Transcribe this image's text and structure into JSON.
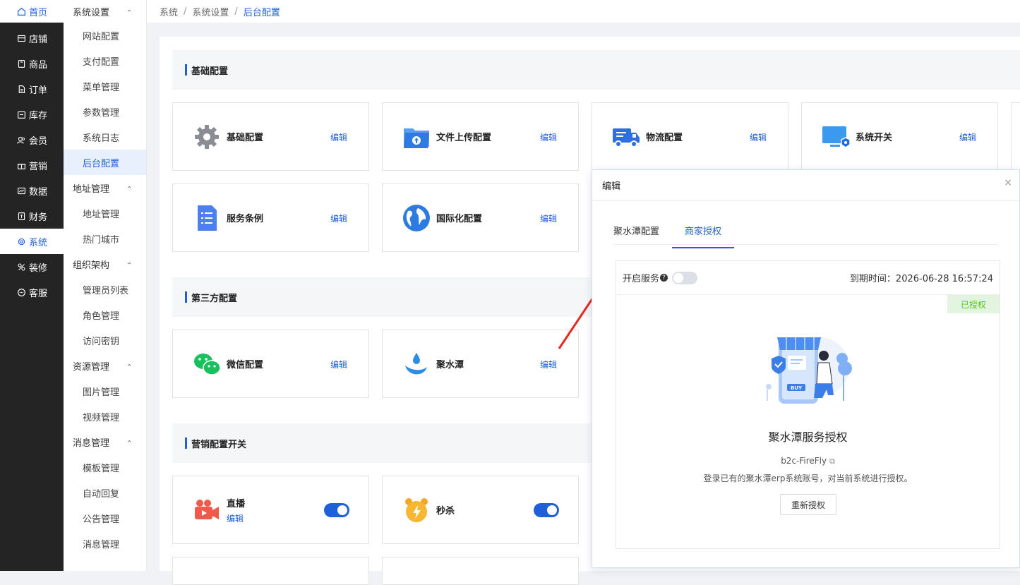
{
  "nav": {
    "home": "首页",
    "items": [
      "店铺",
      "商品",
      "订单",
      "库存",
      "会员",
      "营销",
      "数据",
      "财务",
      "系统",
      "装修",
      "客服"
    ]
  },
  "subnav": {
    "group1": "系统设置",
    "group1_items": [
      "网站配置",
      "支付配置",
      "菜单管理",
      "参数管理",
      "系统日志",
      "后台配置"
    ],
    "group2": "地址管理",
    "group2_items": [
      "地址管理",
      "热门城市"
    ],
    "group3": "组织架构",
    "group3_items": [
      "管理员列表",
      "角色管理",
      "访问密钥"
    ],
    "group4": "资源管理",
    "group4_items": [
      "图片管理",
      "视频管理"
    ],
    "group5": "消息管理",
    "group5_items": [
      "模板管理",
      "自动回复",
      "公告管理",
      "消息管理"
    ]
  },
  "breadcrumb": {
    "a": "系统",
    "b": "系统设置",
    "c": "后台配置"
  },
  "sections": {
    "basic": "基础配置",
    "third": "第三方配置",
    "marketing": "营销配置开关"
  },
  "cards": {
    "edit": "编辑",
    "basic_cfg": "基础配置",
    "upload": "文件上传配置",
    "logistics": "物流配置",
    "switch": "系统开关",
    "terms": "服务条例",
    "i18n": "国际化配置",
    "wechat": "微信配置",
    "jst": "聚水潭",
    "live": "直播",
    "seckill": "秒杀"
  },
  "dialog": {
    "title": "编辑",
    "close": "×",
    "tab1": "聚水潭配置",
    "tab2": "商家授权",
    "service_label": "开启服务",
    "expire": "到期时间：2026-06-28 16:57:24",
    "badge": "已授权",
    "panel_title": "聚水潭服务授权",
    "account": "b2c-FireFly",
    "desc": "登录已有的聚水潭erp系统账号，对当前系统进行授权。",
    "reauth": "重新授权"
  }
}
